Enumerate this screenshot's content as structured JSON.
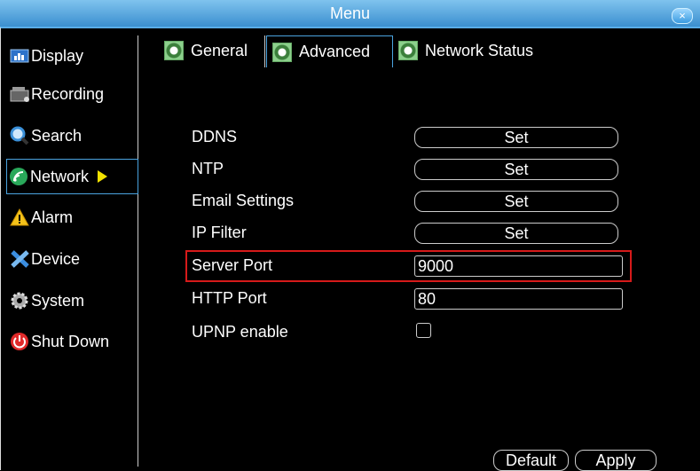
{
  "window": {
    "title": "Menu",
    "close_label": "×"
  },
  "sidebar": {
    "items": [
      {
        "label": "Display"
      },
      {
        "label": "Recording"
      },
      {
        "label": "Search"
      },
      {
        "label": "Network"
      },
      {
        "label": "Alarm"
      },
      {
        "label": "Device"
      },
      {
        "label": "System"
      },
      {
        "label": "Shut Down"
      }
    ],
    "active": "Network"
  },
  "tabs": [
    {
      "label": "General"
    },
    {
      "label": "Advanced"
    },
    {
      "label": "Network Status"
    }
  ],
  "active_tab": "Advanced",
  "settings": {
    "ddns": {
      "label": "DDNS",
      "button": "Set"
    },
    "ntp": {
      "label": "NTP",
      "button": "Set"
    },
    "email": {
      "label": "Email Settings",
      "button": "Set"
    },
    "ip_filter": {
      "label": "IP Filter",
      "button": "Set"
    },
    "server_port": {
      "label": "Server Port",
      "value": "9000"
    },
    "http_port": {
      "label": "HTTP Port",
      "value": "80"
    },
    "upnp": {
      "label": "UPNP enable",
      "checked": false
    }
  },
  "footer": {
    "default_label": "Default",
    "apply_label": "Apply"
  },
  "colors": {
    "accent": "#4aa3df",
    "highlight": "#d61a1a",
    "title_bar": "#3b8fd0",
    "active_arrow": "#f2e200"
  }
}
